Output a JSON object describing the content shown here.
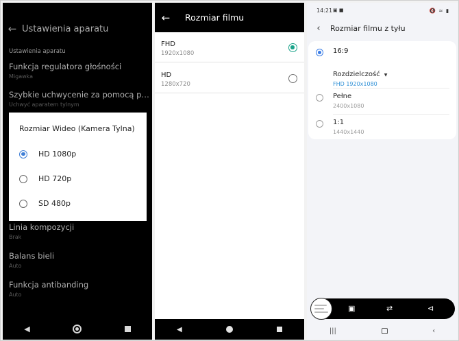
{
  "phone1": {
    "title": "Ustawienia aparatu",
    "section": "Ustawienia aparatu",
    "items": [
      {
        "title": "Funkcja regulatora głośności",
        "sub": "Migawka"
      },
      {
        "title": "Szybkie uchwycenie za pomocą pod...",
        "sub": "Uchwyć aparatem tylnym"
      },
      {
        "title": "Linia kompozycji",
        "sub": "Brak"
      },
      {
        "title": "Balans bieli",
        "sub": "Auto"
      },
      {
        "title": "Funkcja antibanding",
        "sub": "Auto"
      }
    ],
    "dialog": {
      "title": "Rozmiar Wideo (Kamera Tylna)",
      "options": [
        "HD 1080p",
        "HD 720p",
        "SD 480p"
      ],
      "selected": "HD 1080p"
    }
  },
  "phone2": {
    "title": "Rozmiar filmu",
    "items": [
      {
        "title": "FHD",
        "sub": "1920x1080"
      },
      {
        "title": "HD",
        "sub": "1280x720"
      }
    ],
    "selected": "FHD"
  },
  "phone3": {
    "status_time": "14:21",
    "title": "Rozmiar filmu z tyłu",
    "options": [
      {
        "title": "16:9"
      },
      {
        "title": "Pełne",
        "sub": "2400x1080"
      },
      {
        "title": "1:1",
        "sub": "1440x1440"
      }
    ],
    "selected": "16:9",
    "dropdown": {
      "label": "Rozdzielczość",
      "value": "FHD 1920x1080"
    }
  },
  "colors": {
    "accent_blue": "#3f7fd6",
    "accent_teal": "#1aa38a",
    "link_blue": "#2d8fd6"
  }
}
